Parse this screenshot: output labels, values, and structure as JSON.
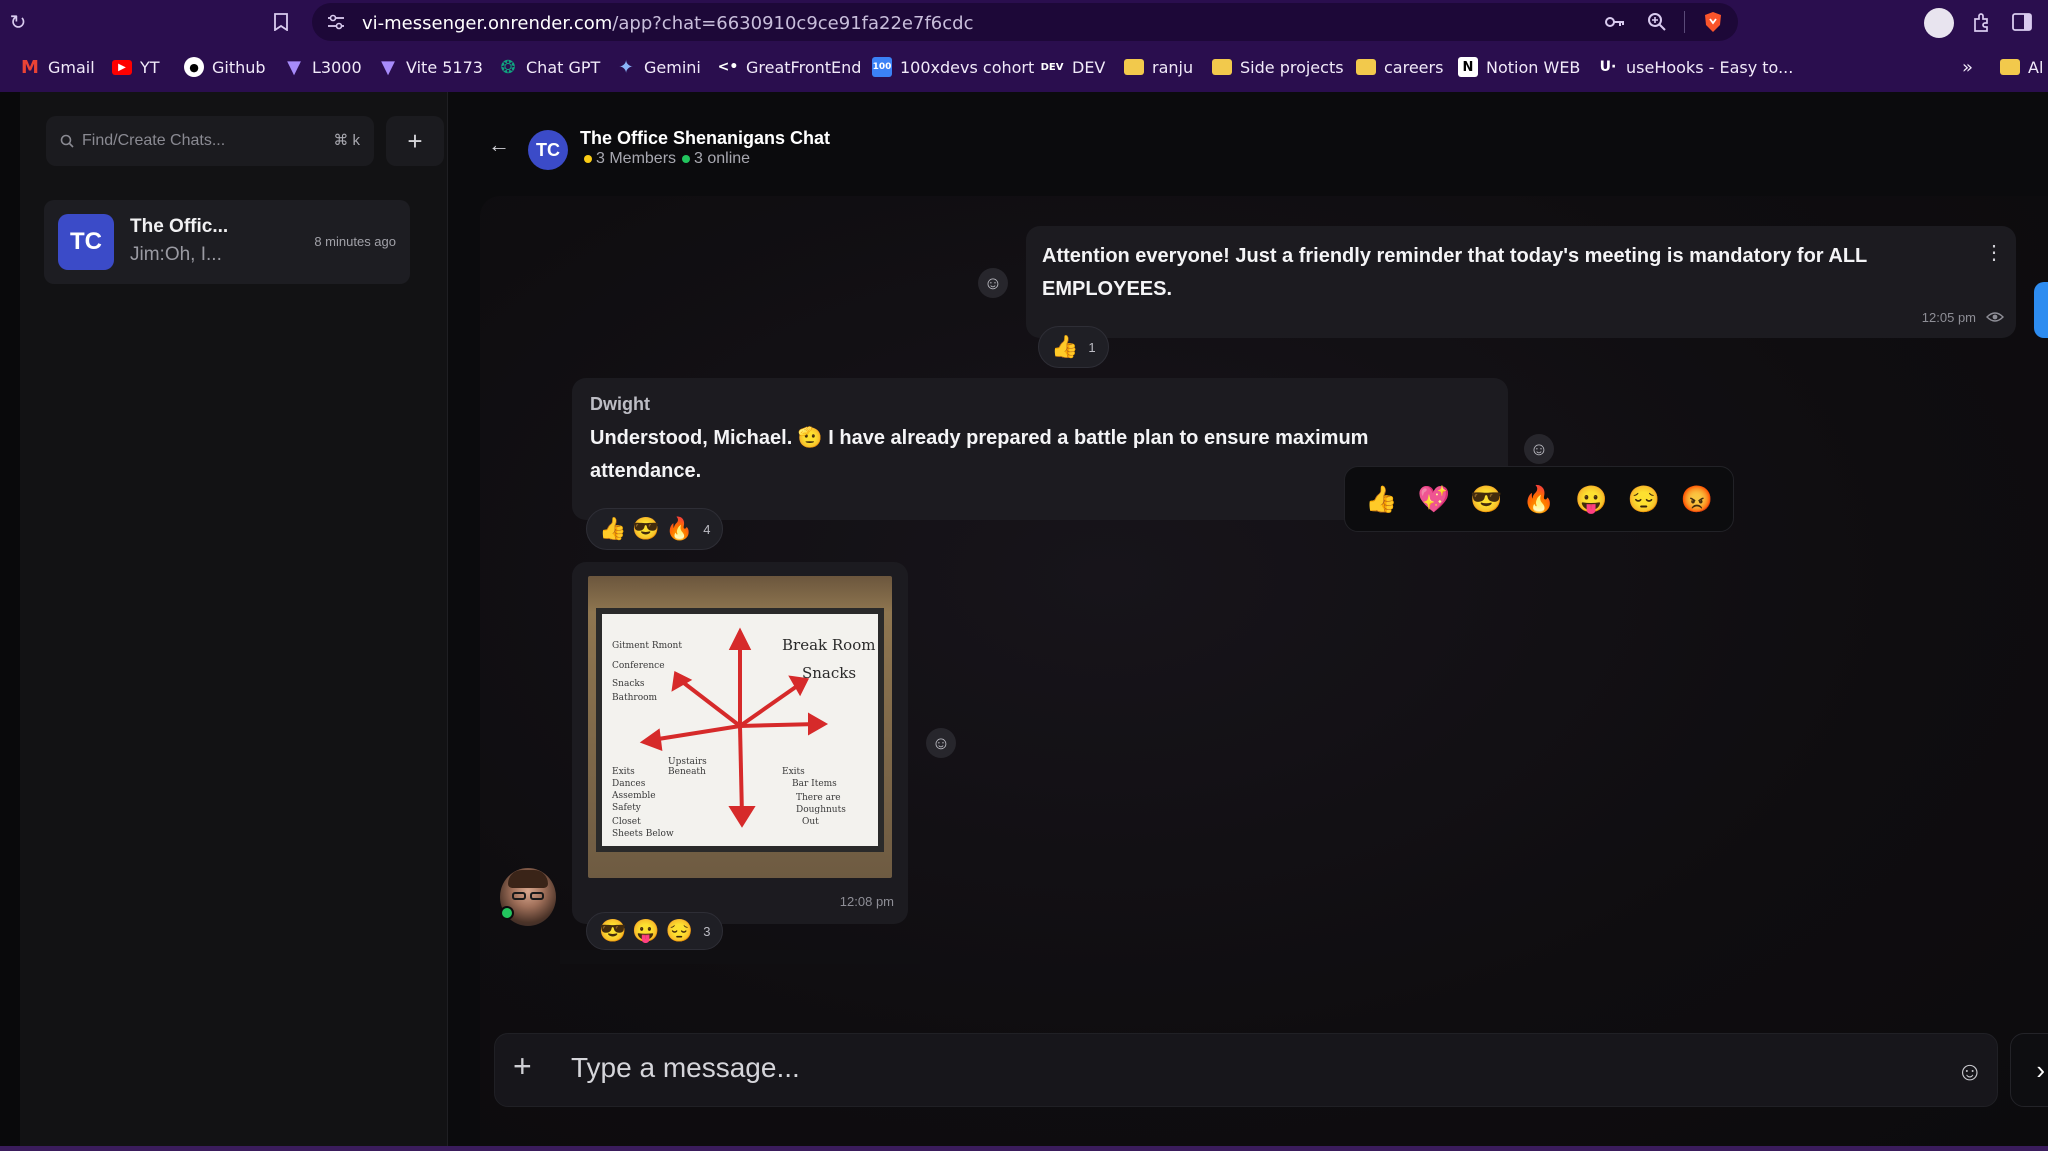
{
  "browser": {
    "url_host": "vi-messenger.onrender.com",
    "url_path": "/app?chat=6630910c9ce91fa22e7f6cdc",
    "bookmarks": [
      {
        "label": "Gmail",
        "icon": "gmail-icon",
        "color": "#ea4335"
      },
      {
        "label": "YT",
        "icon": "youtube-icon",
        "color": "#ff0000"
      },
      {
        "label": "Github",
        "icon": "github-icon",
        "color": "#ffffff"
      },
      {
        "label": "L3000",
        "icon": "vite-icon",
        "color": "#a78bfa"
      },
      {
        "label": "Vite 5173",
        "icon": "vite-icon",
        "color": "#a78bfa"
      },
      {
        "label": "Chat GPT",
        "icon": "chatgpt-icon",
        "color": "#10a37f"
      },
      {
        "label": "Gemini",
        "icon": "gemini-icon",
        "color": "#8ab4f8"
      },
      {
        "label": "GreatFrontEnd",
        "icon": "greatfrontend-icon",
        "color": "#ffffff"
      },
      {
        "label": "100xdevs cohort",
        "icon": "100xdevs-icon",
        "color": "#3b82f6"
      },
      {
        "label": "DEV",
        "icon": "dev-icon",
        "color": "#ffffff"
      },
      {
        "label": "ranju",
        "icon": "folder-icon",
        "color": "#f2c94c"
      },
      {
        "label": "Side projects",
        "icon": "folder-icon",
        "color": "#f2c94c"
      },
      {
        "label": "careers",
        "icon": "folder-icon",
        "color": "#f2c94c"
      },
      {
        "label": "Notion WEB",
        "icon": "notion-icon",
        "color": "#ffffff"
      },
      {
        "label": "useHooks - Easy to...",
        "icon": "usehooks-icon",
        "color": "#ffffff"
      }
    ],
    "overflow": "»",
    "all_bookmarks": "Al"
  },
  "sidebar": {
    "search_placeholder": "Find/Create Chats...",
    "shortcut": "⌘ k",
    "new_chat": "+",
    "chats": [
      {
        "initials": "TC",
        "name": "The Offic...",
        "preview": "Jim:Oh, I...",
        "time": "8 minutes ago"
      }
    ]
  },
  "header": {
    "back": "←",
    "initials": "TC",
    "title": "The Office Shenanigans Chat",
    "members": "3 Members",
    "online": "3 online",
    "member_dot_color": "#facc15",
    "online_dot_color": "#22c55e"
  },
  "messages": [
    {
      "text_line1": "Attention everyone! Just a friendly reminder that today's meeting is mandatory for ALL",
      "text_line2": "EMPLOYEES.",
      "time": "12:05 pm",
      "menu": "⋮",
      "reactions": [
        "👍"
      ],
      "reaction_count": "1"
    },
    {
      "sender": "Dwight",
      "text_line1": "Understood, Michael. 🫡 I have already prepared a battle plan to ensure maximum",
      "text_line2": "attendance.",
      "reactions": [
        "👍",
        "😎",
        "🔥"
      ],
      "reaction_count": "4"
    },
    {
      "type": "image",
      "board_text_title1": "Break Room",
      "board_text_title2": "Snacks",
      "time": "12:08 pm",
      "reactions": [
        "😎",
        "😛",
        "😔"
      ],
      "reaction_count": "3"
    }
  ],
  "emoji_picker": [
    "👍",
    "💖",
    "😎",
    "🔥",
    "😛",
    "😔",
    "😡"
  ],
  "composer": {
    "attach": "+",
    "placeholder": "Type a message...",
    "emoji": "☺",
    "send": "›"
  }
}
